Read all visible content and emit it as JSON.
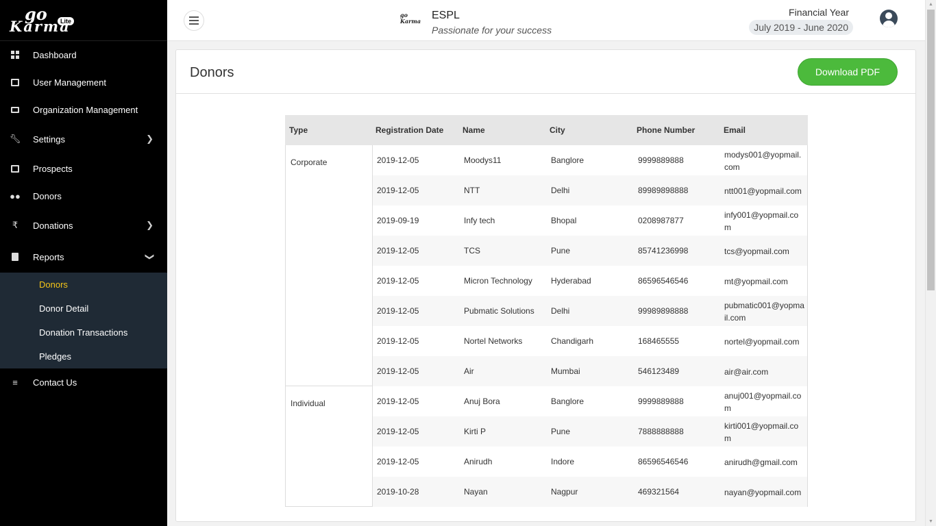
{
  "brand": {
    "logo_go": "go",
    "logo_karma": "Karma",
    "logo_lite": "Lite"
  },
  "sidebar": {
    "items": [
      {
        "label": "Dashboard",
        "icon": "dashboard-icon"
      },
      {
        "label": "User Management",
        "icon": "user-card-icon"
      },
      {
        "label": "Organization Management",
        "icon": "organization-icon"
      },
      {
        "label": "Settings",
        "icon": "wrench-icon"
      },
      {
        "label": "Prospects",
        "icon": "prospects-icon"
      },
      {
        "label": "Donors",
        "icon": "people-icon"
      },
      {
        "label": "Donations",
        "icon": "rupee-icon"
      },
      {
        "label": "Reports",
        "icon": "book-icon"
      },
      {
        "label": "Contact Us",
        "icon": "list-icon"
      }
    ],
    "reports_sub": [
      {
        "label": "Donors",
        "active": true
      },
      {
        "label": "Donor Detail"
      },
      {
        "label": "Donation Transactions"
      },
      {
        "label": "Pledges"
      }
    ]
  },
  "header": {
    "org_name": "ESPL",
    "org_tagline": "Passionate for your success",
    "fy_label": "Financial Year",
    "fy_value": "July 2019 - June 2020"
  },
  "page": {
    "title": "Donors",
    "download_label": "Download PDF"
  },
  "table": {
    "columns": [
      "Type",
      "Registration Date",
      "Name",
      "City",
      "Phone Number",
      "Email"
    ],
    "groups": [
      {
        "type": "Corporate",
        "rows": [
          {
            "date": "2019-12-05",
            "name": "Moodys11",
            "city": "Banglore",
            "phone": "9999889888",
            "email": "modys001@yopmail.com"
          },
          {
            "date": "2019-12-05",
            "name": "NTT",
            "city": "Delhi",
            "phone": "89989898888",
            "email": "ntt001@yopmail.com"
          },
          {
            "date": "2019-09-19",
            "name": "Infy tech",
            "city": "Bhopal",
            "phone": "0208987877",
            "email": "infy001@yopmail.com"
          },
          {
            "date": "2019-12-05",
            "name": "TCS",
            "city": "Pune",
            "phone": "85741236998",
            "email": "tcs@yopmail.com"
          },
          {
            "date": "2019-12-05",
            "name": "Micron Technology",
            "city": "Hyderabad",
            "phone": "86596546546",
            "email": "mt@yopmail.com"
          },
          {
            "date": "2019-12-05",
            "name": "Pubmatic Solutions",
            "city": "Delhi",
            "phone": "99989898888",
            "email": "pubmatic001@yopmail.com"
          },
          {
            "date": "2019-12-05",
            "name": "Nortel Networks",
            "city": "Chandigarh",
            "phone": "168465555",
            "email": "nortel@yopmail.com"
          },
          {
            "date": "2019-12-05",
            "name": "Air",
            "city": "Mumbai",
            "phone": "546123489",
            "email": "air@air.com"
          }
        ]
      },
      {
        "type": "Individual",
        "rows": [
          {
            "date": "2019-12-05",
            "name": "Anuj Bora",
            "city": "Banglore",
            "phone": "9999889888",
            "email": "anuj001@yopmail.com"
          },
          {
            "date": "2019-12-05",
            "name": "Kirti P",
            "city": "Pune",
            "phone": "7888888888",
            "email": "kirti001@yopmail.com"
          },
          {
            "date": "2019-12-05",
            "name": "Anirudh",
            "city": "Indore",
            "phone": "86596546546",
            "email": "anirudh@gmail.com"
          },
          {
            "date": "2019-10-28",
            "name": "Nayan",
            "city": "Nagpur",
            "phone": "469321564",
            "email": "nayan@yopmail.com"
          }
        ]
      }
    ]
  }
}
